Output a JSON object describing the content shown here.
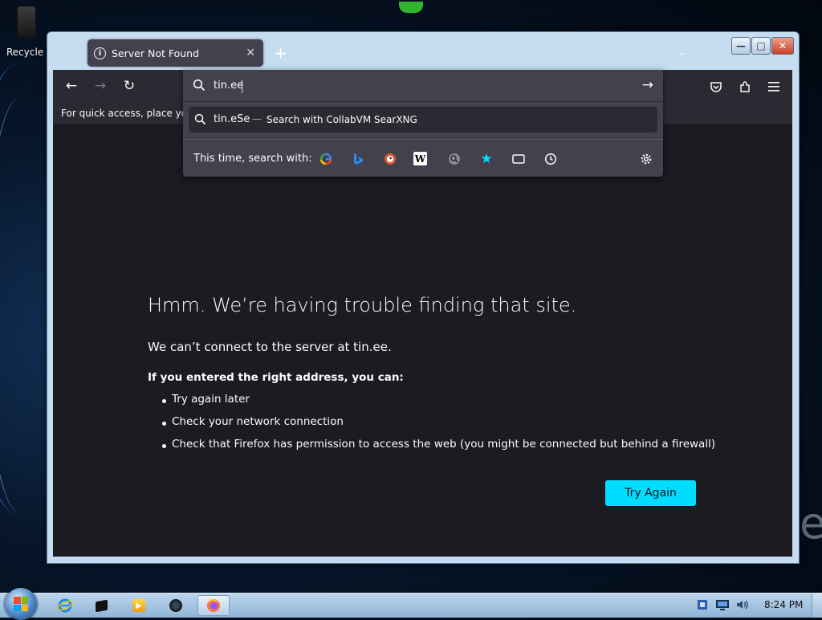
{
  "desktop": {
    "recycle_bin_label": "Recycle Bin"
  },
  "browser": {
    "tab": {
      "title": "Server Not Found",
      "icon": "info-icon"
    },
    "new_tab_symbol": "+",
    "urlbar": {
      "value": "tin.ee",
      "suggestion_query": "tin.eSe",
      "suggestion_separator": "—",
      "suggestion_action": "Search with CollabVM SearXNG",
      "search_with_label": "This time, search with:",
      "engines": [
        "google-icon",
        "bing-icon",
        "duckduckgo-icon",
        "wikipedia-icon",
        "searxng-icon",
        "bookmarks-icon",
        "tabs-icon",
        "history-icon"
      ]
    },
    "bookmarks_toolbar_text": "For quick access, place your bookmarks here on the bookmarks toolbar.",
    "error_page": {
      "title": "Hmm. We’re having trouble finding that site.",
      "subtitle": "We can’t connect to the server at tin.ee.",
      "list_heading": "If you entered the right address, you can:",
      "suggestions": [
        "Try again later",
        "Check your network connection",
        "Check that Firefox has permission to access the web (you might be connected but behind a firewall)"
      ],
      "try_again_label": "Try Again"
    },
    "accent_color": "#00ddff"
  },
  "taskbar": {
    "clock": "8:24 PM"
  }
}
